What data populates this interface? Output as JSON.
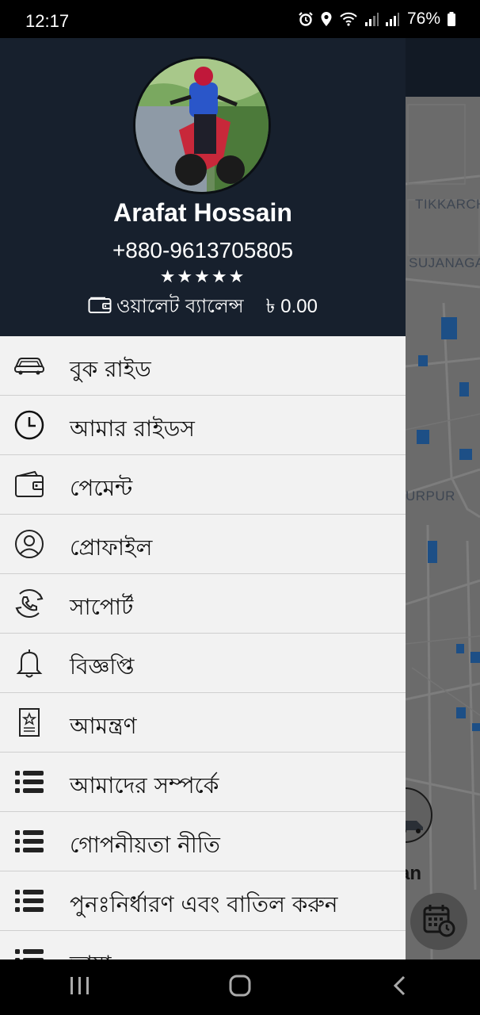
{
  "status_bar": {
    "time": "12:17",
    "battery": "76%",
    "icons": [
      "alarm-icon",
      "location-icon",
      "wifi-icon",
      "signal-icon",
      "signal-icon",
      "battery-icon"
    ]
  },
  "map": {
    "labels": [
      "TIKKARCH",
      "SUJANAGA",
      "URPUR"
    ],
    "vehicle_label": "an",
    "colors": {
      "topbar": "#121a25",
      "map_bg": "#6b6b6b",
      "roads": "#7c7c7c",
      "water": "#1d4f86"
    }
  },
  "profile": {
    "name": "Arafat Hossain",
    "phone": "+880-9613705805",
    "rating_stars": "★★★★★",
    "wallet_label": "ওয়ালেট ব্যালেন্স",
    "wallet_amount": "৳ 0.00"
  },
  "menu": {
    "items": [
      {
        "label": "বুক রাইড",
        "icon": "car-icon"
      },
      {
        "label": "আমার রাইডস",
        "icon": "clock-icon"
      },
      {
        "label": "পেমেন্ট",
        "icon": "wallet-icon"
      },
      {
        "label": "প্রোফাইল",
        "icon": "user-icon"
      },
      {
        "label": "সাপোর্ট",
        "icon": "support-phone-icon"
      },
      {
        "label": "বিজ্ঞপ্তি",
        "icon": "bell-icon"
      },
      {
        "label": "আমন্ত্রণ",
        "icon": "invitation-icon"
      },
      {
        "label": "আমাদের সম্পর্কে",
        "icon": "list-icon"
      },
      {
        "label": "গোপনীয়তা নীতি",
        "icon": "list-icon"
      },
      {
        "label": "পুনঃনির্ধারণ এবং বাতিল করুন",
        "icon": "list-icon"
      },
      {
        "label": "ভাষা",
        "icon": "list-icon"
      }
    ]
  },
  "colors": {
    "drawer_header": "#17202d",
    "drawer_bg": "#f2f2f2",
    "divider": "#cfcfcf"
  }
}
